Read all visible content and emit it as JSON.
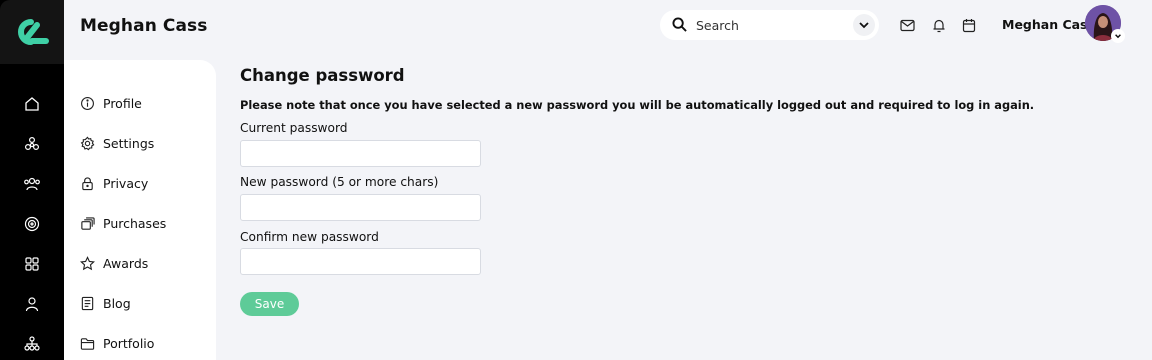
{
  "header": {
    "user_title": "Meghan Cass",
    "user_name": "Meghan Cass",
    "search": {
      "placeholder": "Search",
      "value": ""
    }
  },
  "icons": {
    "logo": "brand-logo",
    "rail": [
      "home-icon",
      "network-icon",
      "people-icon",
      "target-icon",
      "apps-icon",
      "user-icon",
      "org-chart-icon"
    ],
    "header": [
      "search-icon",
      "chevron-down-icon",
      "mail-icon",
      "bell-icon",
      "calendar-icon"
    ]
  },
  "colors": {
    "accent": "#5ecb98",
    "logo": "#3fd0a6",
    "rail_bg": "#000000",
    "page_bg": "#f3f4f8"
  },
  "sidebar": {
    "items": [
      {
        "label": "Profile",
        "icon": "info-icon"
      },
      {
        "label": "Settings",
        "icon": "gear-icon"
      },
      {
        "label": "Privacy",
        "icon": "lock-icon"
      },
      {
        "label": "Purchases",
        "icon": "stack-icon"
      },
      {
        "label": "Awards",
        "icon": "star-icon"
      },
      {
        "label": "Blog",
        "icon": "document-icon"
      },
      {
        "label": "Portfolio",
        "icon": "folder-icon"
      }
    ]
  },
  "form": {
    "title": "Change password",
    "notice": "Please note that once you have selected a new password you will be automatically logged out and required to log in again.",
    "fields": [
      {
        "label": "Current password",
        "value": ""
      },
      {
        "label": "New password (5 or more chars)",
        "value": ""
      },
      {
        "label": "Confirm new password",
        "value": ""
      }
    ],
    "save_label": "Save"
  }
}
